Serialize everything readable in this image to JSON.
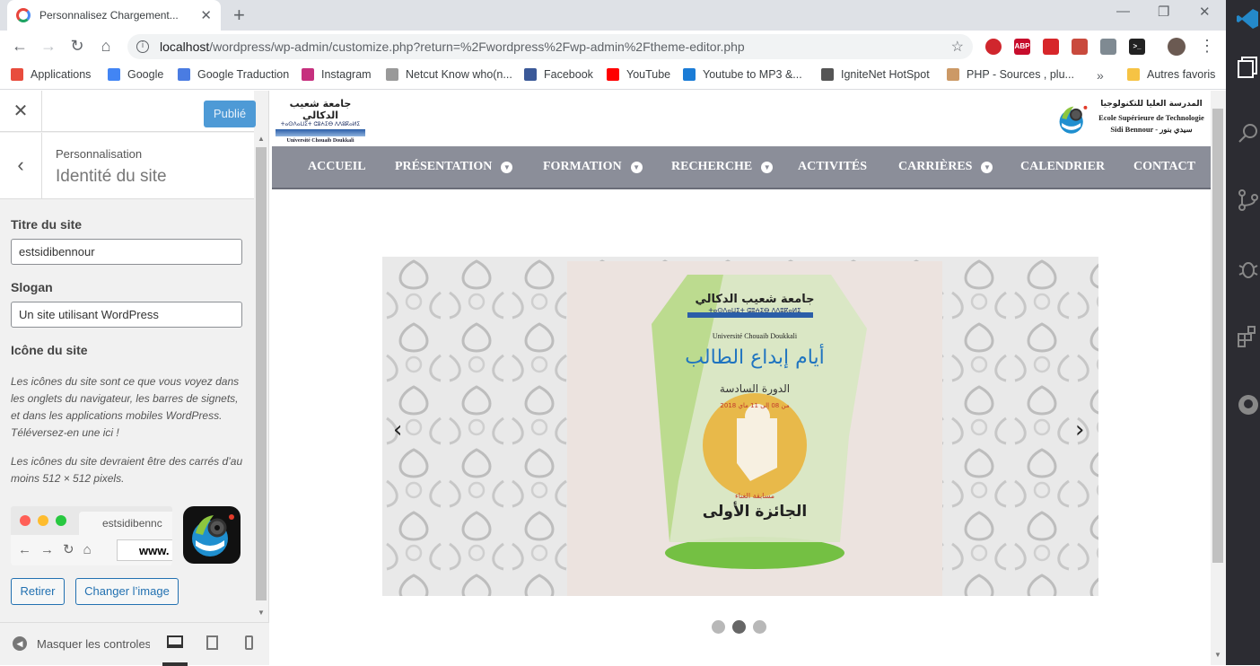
{
  "browser": {
    "tab_title": "Personnalisez Chargement...",
    "tab_close": "✕",
    "new_tab": "+",
    "win_min": "—",
    "win_max": "❐",
    "win_close": "✕",
    "url_host": "localhost",
    "url_path": "/wordpress/wp-admin/customize.php?return=%2Fwordpress%2Fwp-admin%2Ftheme-editor.php",
    "extensions": [
      {
        "name": "adblock-icon",
        "label": "",
        "color": "#d0262d"
      },
      {
        "name": "abp-icon",
        "label": "ABP",
        "color": "#c70d2c"
      },
      {
        "name": "video-ext-icon",
        "label": "",
        "color": "#d7262a"
      },
      {
        "name": "blocker-ext-icon",
        "label": "",
        "color": "#c94a3d"
      },
      {
        "name": "image-ext-icon",
        "label": "",
        "color": "#7f8a92"
      },
      {
        "name": "terminal-ext-icon",
        "label": ">_",
        "color": "#222222"
      }
    ]
  },
  "bookmarks": [
    {
      "label": "Applications",
      "color": "#e84c3d",
      "icon": "apps-grid-icon"
    },
    {
      "label": "Google",
      "color": "#4285f4",
      "icon": "google-icon"
    },
    {
      "label": "Google Traduction",
      "color": "#4a7ce2",
      "icon": "translate-icon"
    },
    {
      "label": "Instagram",
      "color": "#c6307e",
      "icon": "instagram-icon"
    },
    {
      "label": "Netcut Know who(n...",
      "color": "#999999",
      "icon": "netcut-icon"
    },
    {
      "label": "Facebook",
      "color": "#3b5998",
      "icon": "facebook-icon"
    },
    {
      "label": "YouTube",
      "color": "#ff0000",
      "icon": "youtube-icon"
    },
    {
      "label": "Youtube to MP3 &...",
      "color": "#1b7cd6",
      "icon": "mp3-icon"
    },
    {
      "label": "IgniteNet HotSpot",
      "color": "#555555",
      "icon": "globe-icon"
    },
    {
      "label": "PHP - Sources , plu...",
      "color": "#cc9966",
      "icon": "php-icon"
    }
  ],
  "bookmarks_more": "»",
  "bookmarks_other": "Autres favoris",
  "customizer": {
    "close": "✕",
    "publish": "Publié",
    "back": "‹",
    "breadcrumb": "Personnalisation",
    "section_title": "Identité du site",
    "site_title_label": "Titre du site",
    "site_title_value": "estsidibennour",
    "tagline_label": "Slogan",
    "tagline_value": "Un site utilisant WordPress",
    "icon_label": "Icône du site",
    "icon_desc1": "Les icônes du site sont ce que vous voyez dans les onglets du navigateur, les barres de signets, et dans les applications mobiles WordPress. Téléversez-en une ici !",
    "icon_desc2": "Les icônes du site devraient être des carrés d’au moins 512 × 512 pixels.",
    "preview_tab": "estsidibennc",
    "preview_url": "www.",
    "remove": "Retirer",
    "change": "Changer l’image",
    "hide_controls": "Masquer les controles"
  },
  "site": {
    "logo_left_arabic": "جامعة شعيب الدكالي",
    "logo_left_tifinagh": "ⵜⴰⵙⴷⴰⵡⵉⵜ ⵛⵓⵄⵉⴱ ⴷⴷⵓⴽⴰⵍⵉ",
    "logo_left_latin": "Université Chouaib Doukkali",
    "logo_right_arabic": "المدرسة العليا للتكنولوجيا",
    "logo_right_line1": "Ecole Supérieure de Technologie",
    "logo_right_line2": "Sidi Bennour - سيدي بنور",
    "nav": [
      {
        "label": "ACCUEIL",
        "caret": false
      },
      {
        "label": "PRÉSENTATION",
        "caret": true
      },
      {
        "label": "FORMATION",
        "caret": true
      },
      {
        "label": "RECHERCHE",
        "caret": true
      },
      {
        "label": "ACTIVITÉS",
        "caret": false
      },
      {
        "label": "CARRIÈRES",
        "caret": true
      },
      {
        "label": "CALENDRIER",
        "caret": false
      },
      {
        "label": "CONTACT",
        "caret": false
      }
    ],
    "slide": {
      "uni_arabic": "جامعة شعيب الدكالي",
      "uni_tifinagh": "ⵜⴰⵙⴷⴰⵡⵉⵜ ⵛⵓⵄⵉⴱ ⴷⴷⵓⴽⴰⵍⵉ",
      "uni_latin": "Université Chouaib Doukkali",
      "headline": "أيام إبداع الطالب",
      "edition": "الدورة السادسة",
      "dates": "من 08 إلى 11 ماي 2018",
      "category": "مسابقة الغناء",
      "prize": "الجائزة الأولى"
    },
    "prev_arrow": "‹",
    "next_arrow": "›",
    "active_slide": 2,
    "slide_count": 3
  }
}
